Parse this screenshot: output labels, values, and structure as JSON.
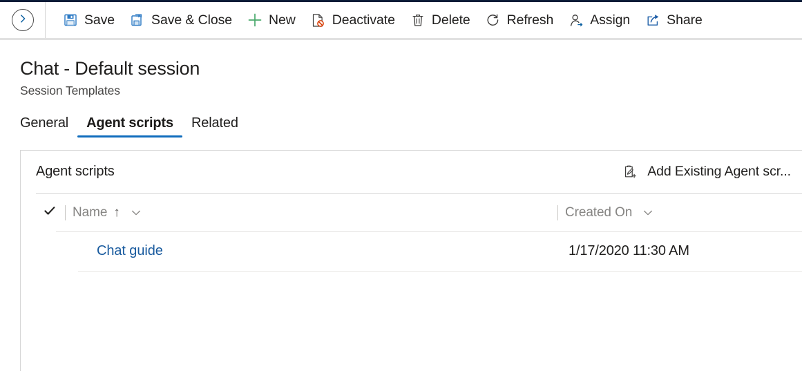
{
  "top_band_color": "#0b1c38",
  "accent_color": "#0f6cbd",
  "link_color": "#185a9e",
  "command_bar": {
    "back_button": {
      "name": "back-button",
      "icon": "chevron-right-circle-icon"
    },
    "buttons": [
      {
        "label": "Save",
        "icon": "save-icon"
      },
      {
        "label": "Save & Close",
        "icon": "save-and-close-icon"
      },
      {
        "label": "New",
        "icon": "plus-icon"
      },
      {
        "label": "Deactivate",
        "icon": "deactivate-icon"
      },
      {
        "label": "Delete",
        "icon": "trash-icon"
      },
      {
        "label": "Refresh",
        "icon": "refresh-icon"
      },
      {
        "label": "Assign",
        "icon": "assign-person-icon"
      },
      {
        "label": "Share",
        "icon": "share-icon"
      }
    ]
  },
  "header": {
    "title": "Chat - Default session",
    "subtitle": "Session Templates"
  },
  "tabs": [
    {
      "label": "General",
      "selected": false
    },
    {
      "label": "Agent scripts",
      "selected": true
    },
    {
      "label": "Related",
      "selected": false
    }
  ],
  "section": {
    "title": "Agent scripts",
    "action": {
      "label": "Add Existing Agent scr...",
      "icon": "add-existing-record-icon"
    }
  },
  "grid": {
    "select_all_icon": "checkmark-icon",
    "columns": [
      {
        "label": "Name",
        "sort": "↑",
        "menu_icon": "chevron-down-icon"
      },
      {
        "label": "Created On",
        "sort": "",
        "menu_icon": "chevron-down-icon"
      }
    ],
    "rows": [
      {
        "name": "Chat guide",
        "created_on": "1/17/2020 11:30 AM"
      }
    ]
  }
}
